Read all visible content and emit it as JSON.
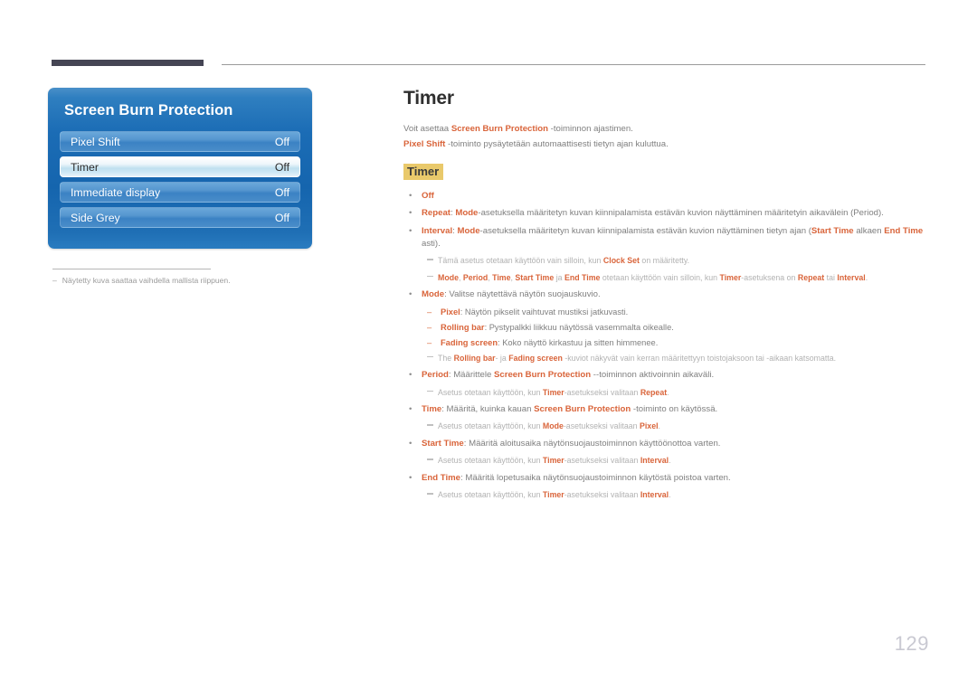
{
  "header": {
    "bar_accent_color": "#454554",
    "rule_color": "#9a9a9a"
  },
  "osd_panel": {
    "title": "Screen Burn Protection",
    "rows": [
      {
        "label": "Pixel Shift",
        "value": "Off",
        "selected": false
      },
      {
        "label": "Timer",
        "value": "Off",
        "selected": true
      },
      {
        "label": "Immediate display",
        "value": "Off",
        "selected": false
      },
      {
        "label": "Side Grey",
        "value": "Off",
        "selected": false
      }
    ],
    "footnote": {
      "dash": "–",
      "text": "Näytetty kuva saattaa vaihdella mallista riippuen."
    }
  },
  "content": {
    "title": "Timer",
    "intro": [
      {
        "parts": [
          {
            "t": "Voit asettaa ",
            "hl": false
          },
          {
            "t": "Screen Burn Protection",
            "hl": true
          },
          {
            "t": " -toiminnon ajastimen.",
            "hl": false
          }
        ]
      },
      {
        "parts": [
          {
            "t": "Pixel Shift",
            "hl": true
          },
          {
            "t": " -toiminto pysäytetään automaattisesti tietyn ajan kuluttua.",
            "hl": false
          }
        ]
      }
    ],
    "sub_heading": "Timer",
    "sub_heading_bg": "#e9c96b",
    "accent_color": "#d9643a",
    "blocks": [
      {
        "kind": "bullet",
        "marker": "•",
        "parts": [
          {
            "t": "Off",
            "hl": true
          }
        ]
      },
      {
        "kind": "bullet",
        "marker": "•",
        "parts": [
          {
            "t": "Repeat",
            "hl": true
          },
          {
            "t": ": ",
            "hl": false
          },
          {
            "t": "Mode",
            "hl": true
          },
          {
            "t": "-asetuksella määritetyn kuvan kiinnipalamista estävän kuvion näyttäminen määritetyin aikavälein (Period).",
            "hl": false
          }
        ]
      },
      {
        "kind": "bullet",
        "marker": "•",
        "parts": [
          {
            "t": "Interval",
            "hl": true
          },
          {
            "t": ": ",
            "hl": false
          },
          {
            "t": "Mode",
            "hl": true
          },
          {
            "t": "-asetuksella määritetyn kuvan kiinnipalamista estävän kuvion näyttäminen tietyn ajan (",
            "hl": false
          },
          {
            "t": "Start Time",
            "hl": true
          },
          {
            "t": " alkaen ",
            "hl": false
          },
          {
            "t": "End Time",
            "hl": true
          },
          {
            "t": " asti).",
            "hl": false
          }
        ]
      },
      {
        "kind": "note",
        "parts": [
          {
            "t": "Tämä asetus otetaan käyttöön vain silloin, kun ",
            "hl": false
          },
          {
            "t": "Clock Set",
            "hl": true
          },
          {
            "t": " on määritetty.",
            "hl": false
          }
        ]
      },
      {
        "kind": "note",
        "parts": [
          {
            "t": "Mode",
            "hl": true
          },
          {
            "t": ", ",
            "hl": false
          },
          {
            "t": "Period",
            "hl": true
          },
          {
            "t": ", ",
            "hl": false
          },
          {
            "t": "Time",
            "hl": true
          },
          {
            "t": ", ",
            "hl": false
          },
          {
            "t": "Start Time",
            "hl": true
          },
          {
            "t": " ja ",
            "hl": false
          },
          {
            "t": "End Time",
            "hl": true
          },
          {
            "t": " otetaan käyttöön vain silloin, kun ",
            "hl": false
          },
          {
            "t": "Timer",
            "hl": true
          },
          {
            "t": "-asetuksena on ",
            "hl": false
          },
          {
            "t": "Repeat",
            "hl": true
          },
          {
            "t": " tai ",
            "hl": false
          },
          {
            "t": "Interval",
            "hl": true
          },
          {
            "t": ".",
            "hl": false
          }
        ]
      },
      {
        "kind": "bullet",
        "marker": "•",
        "parts": [
          {
            "t": "Mode",
            "hl": true
          },
          {
            "t": ": Valitse näytettävä näytön suojauskuvio.",
            "hl": false
          }
        ]
      },
      {
        "kind": "subbullet",
        "marker": "–",
        "parts": [
          {
            "t": "Pixel",
            "hl": true
          },
          {
            "t": ": Näytön pikselit vaihtuvat mustiksi jatkuvasti.",
            "hl": false
          }
        ]
      },
      {
        "kind": "subbullet",
        "marker": "–",
        "parts": [
          {
            "t": "Rolling bar",
            "hl": true
          },
          {
            "t": ": Pystypalkki liikkuu näytössä vasemmalta oikealle.",
            "hl": false
          }
        ]
      },
      {
        "kind": "subbullet",
        "marker": "–",
        "parts": [
          {
            "t": "Fading screen",
            "hl": true
          },
          {
            "t": ": Koko näyttö kirkastuu ja sitten himmenee.",
            "hl": false
          }
        ]
      },
      {
        "kind": "note",
        "parts": [
          {
            "t": "The ",
            "hl": false
          },
          {
            "t": "Rolling bar",
            "hl": true
          },
          {
            "t": "- ja ",
            "hl": false
          },
          {
            "t": "Fading screen",
            "hl": true
          },
          {
            "t": " -kuviot näkyvät vain kerran määritettyyn toistojaksoon tai -aikaan katsomatta.",
            "hl": false
          }
        ]
      },
      {
        "kind": "bullet",
        "marker": "•",
        "parts": [
          {
            "t": "Period",
            "hl": true
          },
          {
            "t": ": Määrittele ",
            "hl": false
          },
          {
            "t": "Screen Burn Protection",
            "hl": true
          },
          {
            "t": " --toiminnon aktivoinnin aikaväli.",
            "hl": false
          }
        ]
      },
      {
        "kind": "note",
        "parts": [
          {
            "t": "Asetus otetaan käyttöön, kun ",
            "hl": false
          },
          {
            "t": "Timer",
            "hl": true
          },
          {
            "t": "-asetukseksi valitaan ",
            "hl": false
          },
          {
            "t": "Repeat",
            "hl": true
          },
          {
            "t": ".",
            "hl": false
          }
        ]
      },
      {
        "kind": "bullet",
        "marker": "•",
        "parts": [
          {
            "t": "Time",
            "hl": true
          },
          {
            "t": ": Määritä, kuinka kauan ",
            "hl": false
          },
          {
            "t": "Screen Burn Protection",
            "hl": true
          },
          {
            "t": " -toiminto on käytössä.",
            "hl": false
          }
        ]
      },
      {
        "kind": "note",
        "parts": [
          {
            "t": "Asetus otetaan käyttöön, kun ",
            "hl": false
          },
          {
            "t": "Mode",
            "hl": true
          },
          {
            "t": "-asetukseksi valitaan ",
            "hl": false
          },
          {
            "t": "Pixel",
            "hl": true
          },
          {
            "t": ".",
            "hl": false
          }
        ]
      },
      {
        "kind": "bullet",
        "marker": "•",
        "parts": [
          {
            "t": "Start Time",
            "hl": true
          },
          {
            "t": ": Määritä aloitusaika näytönsuojaustoiminnon käyttöönottoa varten.",
            "hl": false
          }
        ]
      },
      {
        "kind": "note",
        "parts": [
          {
            "t": "Asetus otetaan käyttöön, kun ",
            "hl": false
          },
          {
            "t": "Timer",
            "hl": true
          },
          {
            "t": "-asetukseksi valitaan ",
            "hl": false
          },
          {
            "t": "Interval",
            "hl": true
          },
          {
            "t": ".",
            "hl": false
          }
        ]
      },
      {
        "kind": "bullet",
        "marker": "•",
        "parts": [
          {
            "t": "End Time",
            "hl": true
          },
          {
            "t": ": Määritä lopetusaika näytönsuojaustoiminnon käytöstä poistoa varten.",
            "hl": false
          }
        ]
      },
      {
        "kind": "note",
        "parts": [
          {
            "t": "Asetus otetaan käyttöön, kun ",
            "hl": false
          },
          {
            "t": "Timer",
            "hl": true
          },
          {
            "t": "-asetukseksi valitaan ",
            "hl": false
          },
          {
            "t": "Interval",
            "hl": true
          },
          {
            "t": ".",
            "hl": false
          }
        ]
      }
    ]
  },
  "page_number": "129"
}
